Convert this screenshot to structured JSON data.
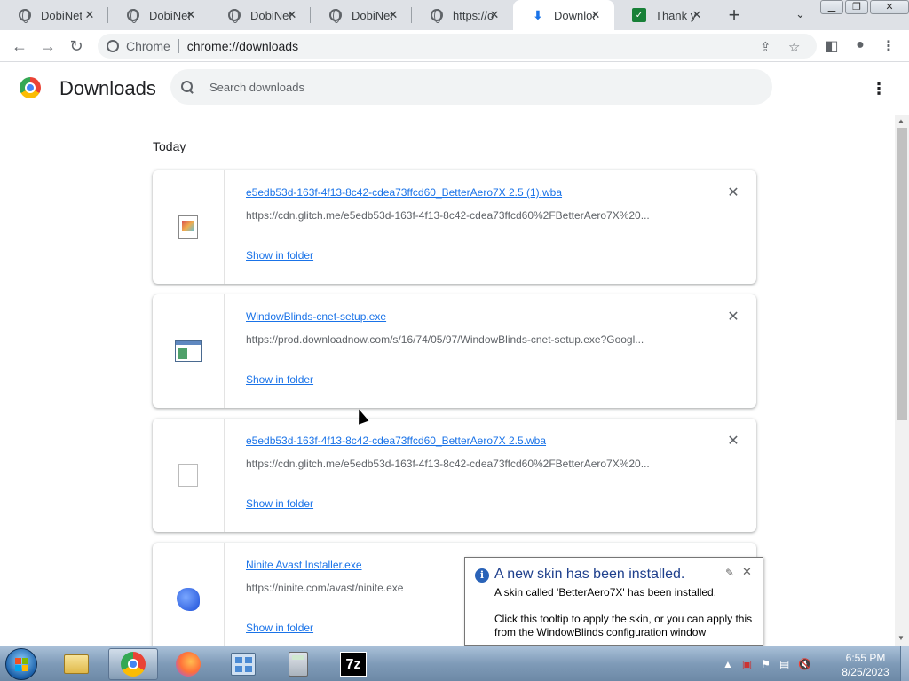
{
  "tabs": [
    {
      "title": "DobiNet",
      "icon": "globe-icon"
    },
    {
      "title": "DobiNet",
      "icon": "globe-icon"
    },
    {
      "title": "DobiNet",
      "icon": "globe-icon"
    },
    {
      "title": "DobiNet",
      "icon": "globe-icon"
    },
    {
      "title": "https://ol",
      "icon": "globe-icon"
    },
    {
      "title": "Downloa",
      "icon": "download-icon",
      "active": true
    },
    {
      "title": "Thank yo",
      "icon": "spreadsheet-icon"
    }
  ],
  "omnibox": {
    "site_label": "Chrome",
    "url": "chrome://downloads"
  },
  "page": {
    "title": "Downloads",
    "search_placeholder": "Search downloads",
    "date_label": "Today"
  },
  "downloads": [
    {
      "file_name": "e5edb53d-163f-4f13-8c42-cdea73ffcd60_BetterAero7X 2.5 (1).wba",
      "url": "https://cdn.glitch.me/e5edb53d-163f-4f13-8c42-cdea73ffcd60%2FBetterAero7X%20...",
      "action": "Show in folder",
      "icon": "wba-file-icon"
    },
    {
      "file_name": "WindowBlinds-cnet-setup.exe",
      "url": "https://prod.downloadnow.com/s/16/74/05/97/WindowBlinds-cnet-setup.exe?Googl...",
      "action": "Show in folder",
      "icon": "exe-file-icon"
    },
    {
      "file_name": "e5edb53d-163f-4f13-8c42-cdea73ffcd60_BetterAero7X 2.5.wba",
      "url": "https://cdn.glitch.me/e5edb53d-163f-4f13-8c42-cdea73ffcd60%2FBetterAero7X%20...",
      "action": "Show in folder",
      "icon": "blank-file-icon"
    },
    {
      "file_name": "Ninite Avast Installer.exe",
      "url": "https://ninite.com/avast/ninite.exe",
      "action": "Show in folder",
      "icon": "ninite-icon"
    }
  ],
  "balloon": {
    "title": "A new skin has been installed.",
    "line1": "A skin called 'BetterAero7X' has been installed.",
    "line2": "Click this tooltip to apply the skin, or you can apply this",
    "line3": "from the WindowBlinds configuration window"
  },
  "taskbar": {
    "apps": [
      "file-explorer-icon",
      "chrome-icon",
      "firefox-icon",
      "control-panel-icon",
      "calculator-icon",
      "7zip-icon"
    ],
    "app_7z_label": "7z",
    "time": "6:55 PM",
    "date": "8/25/2023"
  }
}
